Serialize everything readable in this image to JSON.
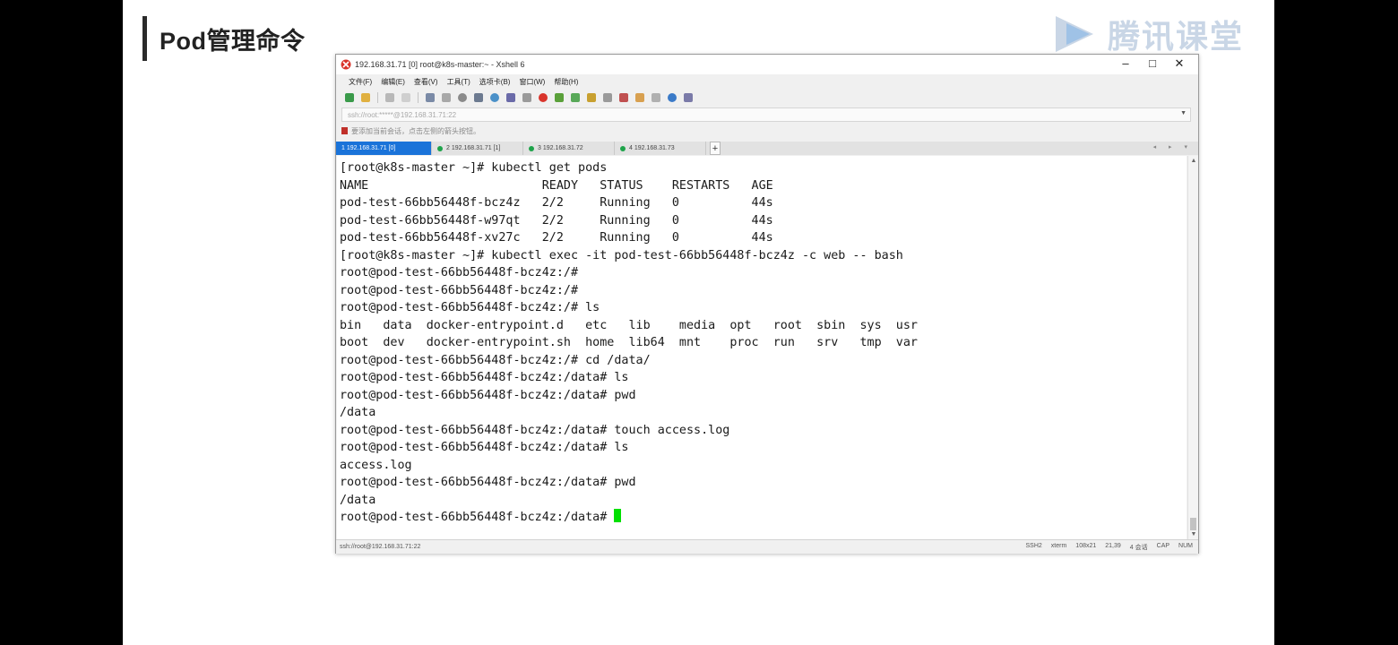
{
  "slide": {
    "title": "Pod管理命令",
    "logo_text": "腾讯课堂"
  },
  "window": {
    "title": "192.168.31.71 [0]    root@k8s-master:~ - Xshell 6",
    "controls": {
      "minimize": "–",
      "maximize": "□",
      "close": "✕"
    }
  },
  "menu": [
    "文件(F)",
    "编辑(E)",
    "查看(V)",
    "工具(T)",
    "选项卡(B)",
    "窗口(W)",
    "帮助(H)"
  ],
  "toolbar_icons": [
    "new-session-icon",
    "open-folder-icon",
    "reconnect-icon",
    "disconnect-icon",
    "properties-icon",
    "copy-icon",
    "find-icon",
    "transfer-icon",
    "globe-icon",
    "color-scheme-icon",
    "font-icon",
    "xftp-icon",
    "xmanager-icon",
    "fullscreen-icon",
    "lock-icon",
    "keyboard-icon",
    "script-icon",
    "compose-icon",
    "layout-icon",
    "help-icon",
    "tips-icon"
  ],
  "accent_colors": {
    "active_tab": "#1a73d9",
    "tab_connected_dot": "#1ea34a",
    "cursor": "#00e000",
    "app_icon": "#d9342b"
  },
  "address_bar": {
    "value": "ssh://root:*****@192.168.31.71:22"
  },
  "hint_bar": {
    "text": "要添加当前会话，点击左侧的箭头按钮。"
  },
  "tabs": [
    {
      "label": "1 192.168.31.71 [0]",
      "active": true
    },
    {
      "label": "2 192.168.31.71 [1]",
      "active": false
    },
    {
      "label": "3 192.168.31.72",
      "active": false
    },
    {
      "label": "4 192.168.31.73",
      "active": false
    }
  ],
  "tab_add_label": "+",
  "tab_nav_label": "◂ ▸ ▾",
  "terminal_lines": [
    "[root@k8s-master ~]# kubectl get pods",
    "NAME                        READY   STATUS    RESTARTS   AGE",
    "pod-test-66bb56448f-bcz4z   2/2     Running   0          44s",
    "pod-test-66bb56448f-w97qt   2/2     Running   0          44s",
    "pod-test-66bb56448f-xv27c   2/2     Running   0          44s",
    "[root@k8s-master ~]# kubectl exec -it pod-test-66bb56448f-bcz4z -c web -- bash",
    "root@pod-test-66bb56448f-bcz4z:/#",
    "root@pod-test-66bb56448f-bcz4z:/#",
    "root@pod-test-66bb56448f-bcz4z:/# ls",
    "bin   data  docker-entrypoint.d   etc   lib    media  opt   root  sbin  sys  usr",
    "boot  dev   docker-entrypoint.sh  home  lib64  mnt    proc  run   srv   tmp  var",
    "root@pod-test-66bb56448f-bcz4z:/# cd /data/",
    "root@pod-test-66bb56448f-bcz4z:/data# ls",
    "root@pod-test-66bb56448f-bcz4z:/data# pwd",
    "/data",
    "root@pod-test-66bb56448f-bcz4z:/data# touch access.log",
    "root@pod-test-66bb56448f-bcz4z:/data# ls",
    "access.log",
    "root@pod-test-66bb56448f-bcz4z:/data# pwd",
    "/data"
  ],
  "prompt_line": "root@pod-test-66bb56448f-bcz4z:/data# ",
  "status_bar": {
    "connection": "ssh://root@192.168.31.71:22",
    "protocol": "SSH2",
    "terminal": "xterm",
    "size": "108x21",
    "position": "21,39",
    "sessions": "4 会话",
    "caps": "CAP",
    "num": "NUM"
  }
}
